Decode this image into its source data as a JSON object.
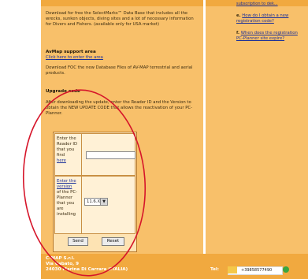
{
  "left_text": {
    "intro": "Download for free the SelectMarks™ Data Base that includes all the wrecks, sunken objects, diving sites and a lot of necessary information for Divers and Fishers. (available only for USA market)",
    "avmap_heading": "AvMap support area",
    "avmap_link": "Click here to enter the area",
    "foc_text": "Download FOC the new Database Files of AV-MAP terrestrial and aerial products.",
    "upgrade_heading": "Upgrade code",
    "upgrade_text": "After downloading the update, enter the Reader ID and the Version to obtain the NEW UPDATE CODE that allows the reactivation of your PC-Planner."
  },
  "form": {
    "reader_label": "Enter the Reader ID that you find",
    "reader_link": "here",
    "reader_value": "",
    "version_link": "Enter the version",
    "version_label": "of the PC-Planner that you are installing",
    "version_value": "11.6.X",
    "send_label": "Send",
    "reset_label": "Reset"
  },
  "sidebar": {
    "top_link": "subscription to dek...",
    "faq_e_key": "e.",
    "faq_e": "How do I obtain a new registration code?",
    "faq_f_key": "f.",
    "faq_f": "When does the registration PC-Planner site expire?"
  },
  "footer": {
    "company": "C-MAP S.r.l.",
    "street": "Via Cabato, 9",
    "city": "24030 Marina Di Carrara (ITALIA)",
    "tel_label": "Tel:",
    "phone": "+39858577490"
  },
  "annotation": {
    "color": "#d6152a",
    "shape": "ellipse"
  },
  "colors": {
    "panel": "#f8c06a",
    "accent": "#f1a93f",
    "form_bg": "#fde3b3"
  }
}
